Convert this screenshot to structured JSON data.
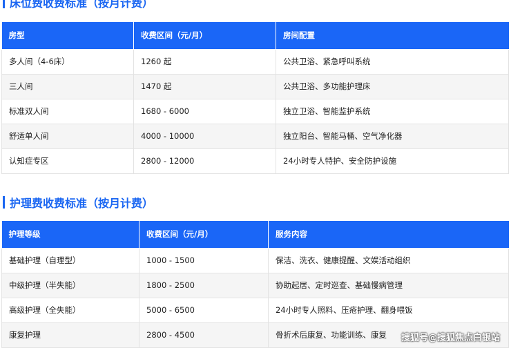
{
  "section1": {
    "title": "床位费收费标准（按月计费）",
    "headers": [
      "房型",
      "收费区间（元/月）",
      "房间配置"
    ],
    "rows": [
      [
        "多人间（4-6床）",
        "1260 起",
        "公共卫浴、紧急呼叫系统"
      ],
      [
        "三人间",
        "1470 起",
        "公共卫浴、多功能护理床"
      ],
      [
        "标准双人间",
        "1680 - 6000",
        "独立卫浴、智能监护系统"
      ],
      [
        "舒适单人间",
        "4000 - 10000",
        "独立阳台、智能马桶、空气净化器"
      ],
      [
        "认知症专区",
        "2800 - 12000",
        "24小时专人特护、安全防护设施"
      ]
    ]
  },
  "section2": {
    "title": "护理费收费标准（按月计费）",
    "headers": [
      "护理等级",
      "收费区间（元/月）",
      "服务内容"
    ],
    "rows": [
      [
        "基础护理（自理型）",
        "1000 - 1500",
        "保洁、洗衣、健康提醒、文娱活动组织"
      ],
      [
        "中级护理（半失能）",
        "1800 - 2500",
        "协助起居、定时巡查、基础慢病管理"
      ],
      [
        "高级护理（全失能）",
        "5000 - 6500",
        "24小时专人照料、压疮护理、翻身喂饭"
      ],
      [
        "康复护理",
        "2800 - 4500",
        "骨折术后康复、功能训练、康复"
      ]
    ]
  },
  "watermark": "搜狐号@搜狐焦点白银站",
  "colors": {
    "accent": "#1a66f2",
    "header_bg": "#1a66f7",
    "alt_row_bg": "#f5f5f5"
  }
}
